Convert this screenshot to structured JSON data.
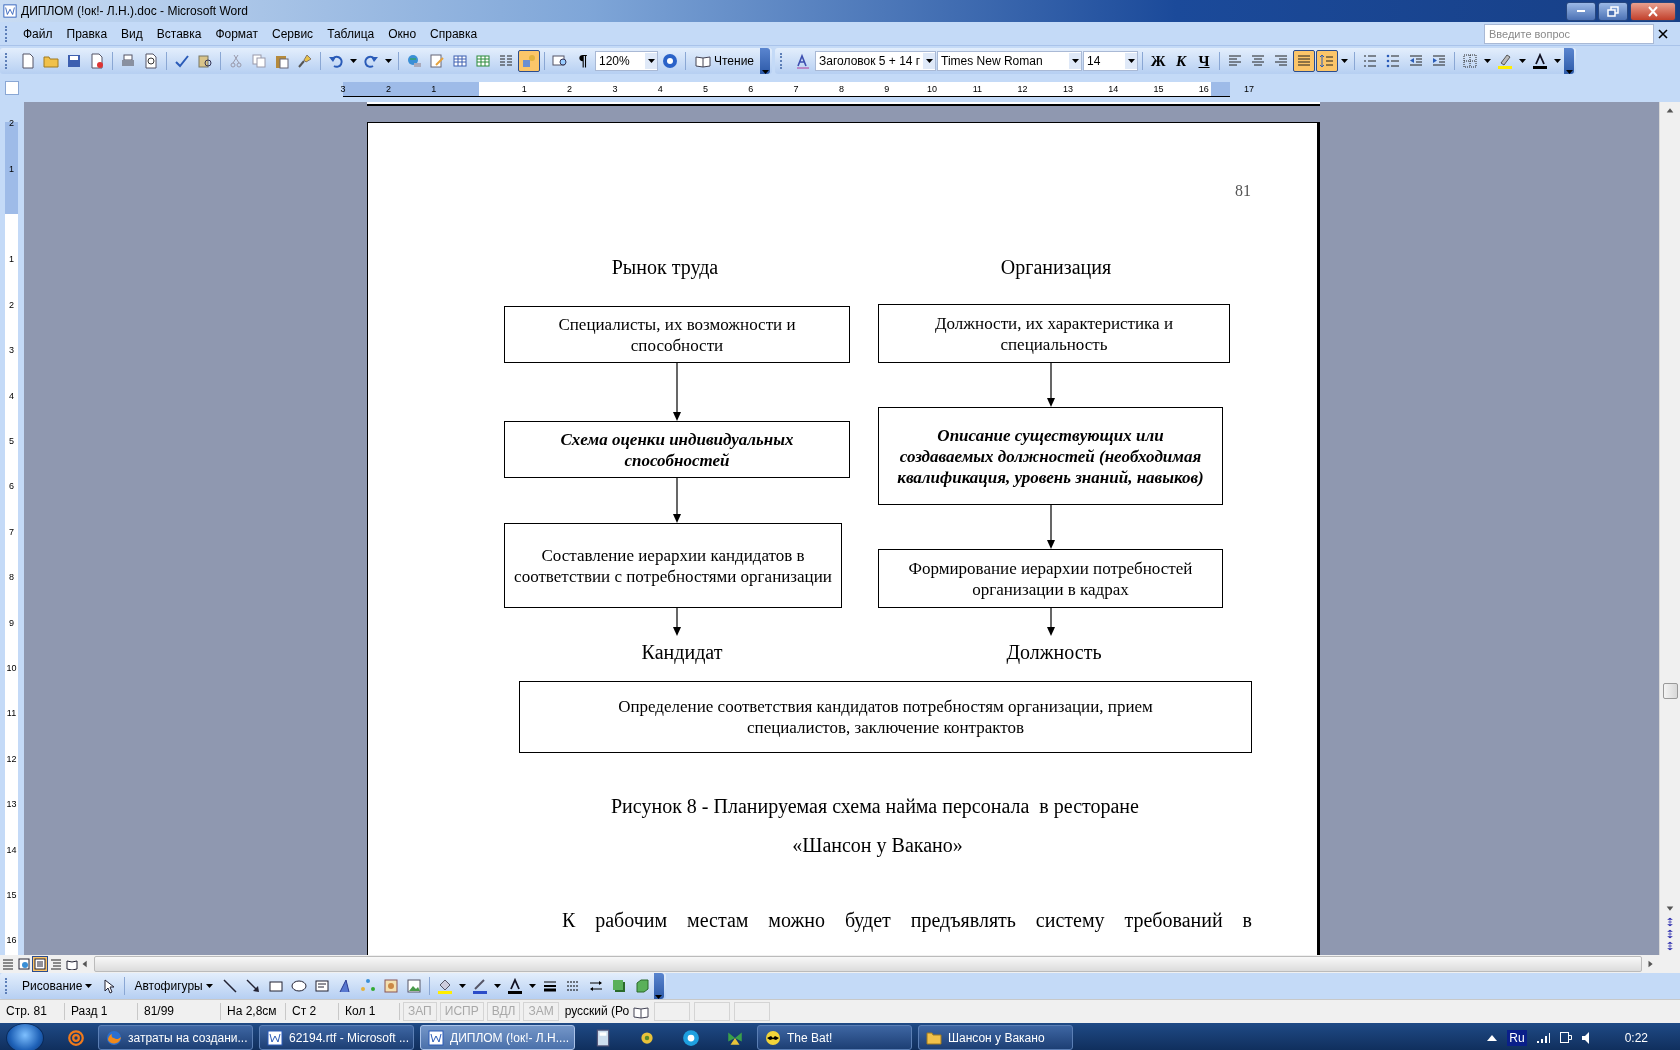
{
  "window": {
    "title": "ДИПЛОМ (!ок!- Л.Н.).doc - Microsoft Word"
  },
  "menu": [
    "Файл",
    "Правка",
    "Вид",
    "Вставка",
    "Формат",
    "Сервис",
    "Таблица",
    "Окно",
    "Справка"
  ],
  "ask_field": {
    "placeholder": "Введите вопрос"
  },
  "standard_toolbar": {
    "drawing_pressed": true,
    "show_marks": "¶",
    "zoom": "120%",
    "reading_button": "Чтение"
  },
  "formatting_toolbar": {
    "style": "Заголовок 5 + 14 г",
    "font": "Times New Roman",
    "size": "14",
    "bold": "Ж",
    "italic": "К",
    "underline": "Ч",
    "alignment": [
      {
        "selected": false
      },
      {
        "selected": false
      },
      {
        "selected": false
      },
      {
        "selected": true
      }
    ],
    "line_spacing_pressed": true
  },
  "ruler": {
    "left_labels": [
      "3",
      "2",
      "1"
    ],
    "right_labels": [
      "1",
      "2",
      "3",
      "4",
      "5",
      "6",
      "7",
      "8",
      "9",
      "10",
      "11",
      "12",
      "13",
      "14",
      "15",
      "16",
      "17"
    ]
  },
  "vertical_ruler": {
    "top_labels": [
      "2",
      "1"
    ],
    "labels": [
      "1",
      "2",
      "3",
      "4",
      "5",
      "6",
      "7",
      "8",
      "9",
      "10",
      "11",
      "12",
      "13",
      "14",
      "15",
      "16"
    ]
  },
  "document": {
    "page_number": "81",
    "diagram": {
      "headings": [
        "Рынок труда",
        "Организация"
      ],
      "boxes": [
        {
          "text": "Специалисты, их возможности и способности",
          "emphasis": false
        },
        {
          "text": "Должности, их характеристика и специальность",
          "emphasis": false
        },
        {
          "text": "Схема оценки индивидуальных способностей",
          "emphasis": true
        },
        {
          "text": "Описание существующих или создаваемых должностей (необходимая квалификация, уровень знаний, навыков)",
          "emphasis": true
        },
        {
          "text": "Составление иерархии кандидатов в соответствии с потребностями организации",
          "emphasis": false
        },
        {
          "text": "Формирование иерархии потребностей организации в кадрах",
          "emphasis": false
        }
      ],
      "outcomes": [
        "Кандидат",
        "Должность"
      ],
      "result_box": "Определение соответствия кандидатов потребностям организации, прием специалистов, заключение контрактов"
    },
    "caption_lines": [
      "Рисунок 8 - Планируемая схема найма персонала  в ресторане",
      "«Шансон у Вакано»"
    ],
    "paragraph": "К рабочим местам можно будет предъявлять систему требований в"
  },
  "view_buttons": [
    {
      "selected": false
    },
    {
      "selected": false
    },
    {
      "selected": true
    },
    {
      "selected": false
    },
    {
      "selected": false
    }
  ],
  "drawing_toolbar": {
    "drawing_menu": "Рисование",
    "autoshapes_menu": "Автофигуры"
  },
  "status_bar": {
    "fields": [
      "Стр. 81",
      "Разд 1",
      "81/99",
      "На 2,8см",
      "Ст 2",
      "Кол 1"
    ],
    "modes": [
      {
        "text": "ЗАП",
        "on": false
      },
      {
        "text": "ИСПР",
        "on": false
      },
      {
        "text": "ВДЛ",
        "on": false
      },
      {
        "text": "ЗАМ",
        "on": false
      }
    ],
    "language": "русский (Ро"
  },
  "taskbar": {
    "buttons": [
      {
        "label": "затраты на создани...",
        "selected": false
      },
      {
        "label": "62194.rtf - Microsoft ...",
        "selected": false
      },
      {
        "label": "ДИПЛОМ (!ок!- Л.Н....",
        "selected": true
      }
    ],
    "more_buttons": [
      {
        "label": "The Bat!",
        "selected": false
      },
      {
        "label": "Шансон у Вакано",
        "selected": false
      }
    ],
    "language": "Ru",
    "clock": "0:22"
  }
}
